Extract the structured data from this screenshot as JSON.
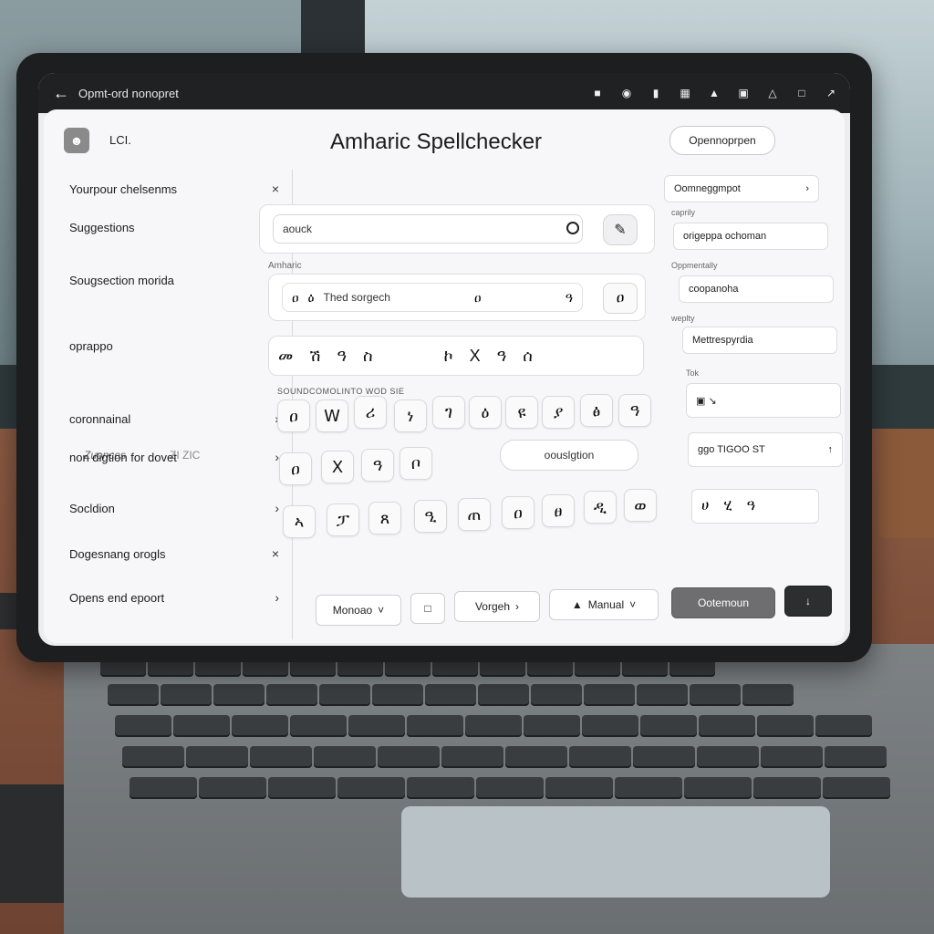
{
  "topbar": {
    "title": "Opmt-ord nonopret",
    "icons": [
      "folder-icon",
      "globe-icon",
      "file-icon",
      "grid-icon",
      "upload-icon",
      "image-icon",
      "warning-icon",
      "window-icon",
      "share-icon"
    ]
  },
  "app": {
    "title": "Amharic Spellchecker",
    "user_name": "LCI.",
    "header_button": "Opennoprpen"
  },
  "sidebar": {
    "items": [
      {
        "label": "Yourpour chelsenms",
        "chevron": "×"
      },
      {
        "label": "Suggestions",
        "chevron": "›"
      },
      {
        "label": "Sougsection morida",
        "chevron": "›"
      },
      {
        "label": "oprappo",
        "chevron": "›"
      },
      {
        "label": "coronnainal",
        "chevron": "›"
      },
      {
        "label": "non digtion for dovet",
        "chevron": "›"
      },
      {
        "label": "Socldion",
        "chevron": "›"
      },
      {
        "label": "Dogesnang orogls",
        "chevron": "×"
      },
      {
        "label": "Opens end epoort",
        "chevron": "›"
      }
    ],
    "muted_left": "Zuonces",
    "muted_right": "ZI ZIC"
  },
  "main": {
    "search_value": "aouck",
    "row_label": "Amharic",
    "suggest_chars": [
      "ዐ",
      "ዕ"
    ],
    "suggest_text": "Thed sorgech",
    "suggest_end": "ዐ",
    "suggest_end2": "ዓ",
    "suggest_btn": "ዐ",
    "char_strip": [
      "መ",
      "ሽ",
      "ዓ",
      "ስ",
      "ኮ",
      "X",
      "ዓ",
      "ሰ"
    ],
    "small_label": "SOUNDCOMOLINTO  WOD  SIE",
    "keys_row1": [
      "ዐ",
      "W",
      "ሪ",
      "ነ",
      "ገ",
      "ዕ",
      "ዩ",
      "ያ",
      "ፅ",
      "ዓ"
    ],
    "keys_row2": [
      "ዐ",
      "X",
      "ዓ",
      "ቦ"
    ],
    "wide_pill": "oouslgtion",
    "keys_row3": [
      "ኣ",
      "ፓ",
      "ጸ",
      "ዒ",
      "ጠ",
      "ዐ",
      "ፀ",
      "ዲ",
      "ወ"
    ]
  },
  "toolbar": {
    "menu_label": "Monoao",
    "vorgeh_label": "Vorgeh",
    "manual_label": "Manual",
    "action_label": "Ootemoun"
  },
  "right_panel": {
    "items": [
      {
        "label": "Oomneggmpot",
        "chevron": "›"
      },
      {
        "label": "origeppa ochoman",
        "chevron": ""
      },
      {
        "label": "coopanoha",
        "chevron": ""
      },
      {
        "label": "Mettrespyrdia",
        "chevron": ""
      }
    ],
    "labels": [
      "caprily",
      "Oppmentally",
      "weplty"
    ],
    "tok_label": "Tok",
    "info_box": "ggo TIGOO  ST",
    "mini_chars": [
      "ሀ",
      "ሂ",
      "ዓ"
    ]
  }
}
